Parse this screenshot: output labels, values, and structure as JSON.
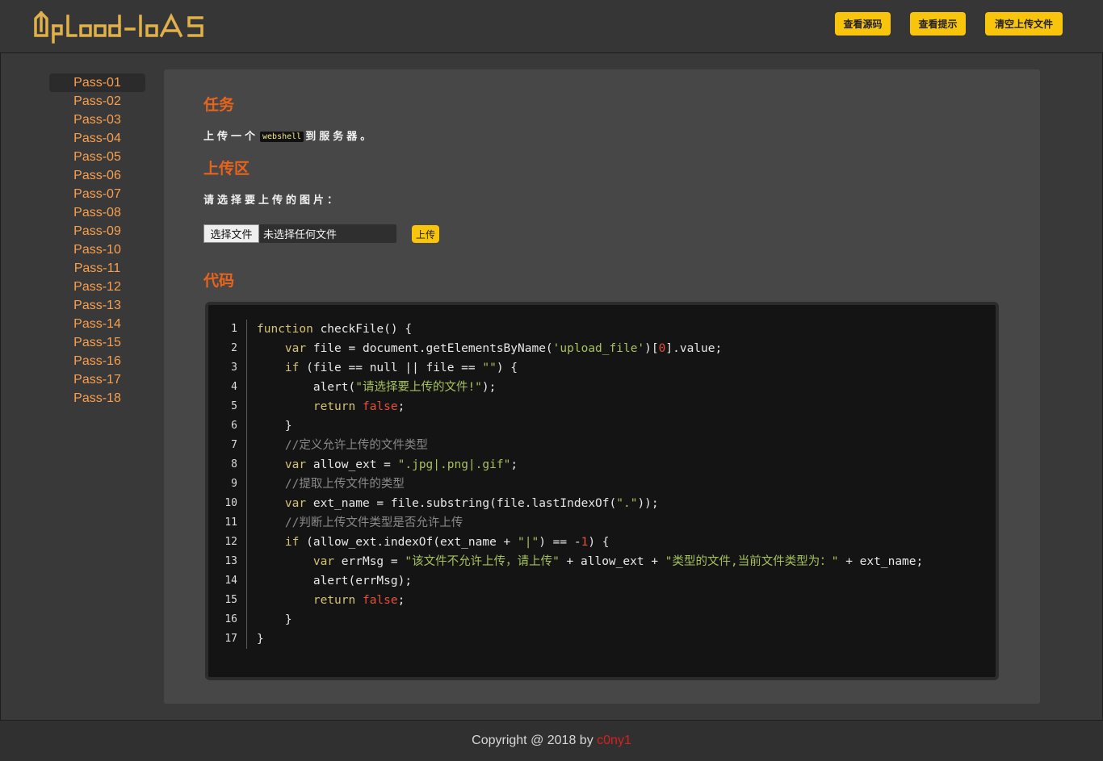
{
  "header": {
    "logo_text": "Upload-labs",
    "buttons": [
      "查看源码",
      "查看提示",
      "清空上传文件"
    ]
  },
  "sidebar": {
    "active_index": 0,
    "items": [
      "Pass-01",
      "Pass-02",
      "Pass-03",
      "Pass-04",
      "Pass-05",
      "Pass-06",
      "Pass-07",
      "Pass-08",
      "Pass-09",
      "Pass-10",
      "Pass-11",
      "Pass-12",
      "Pass-13",
      "Pass-14",
      "Pass-15",
      "Pass-16",
      "Pass-17",
      "Pass-18"
    ]
  },
  "task": {
    "title": "任务",
    "text_before": "上传一个",
    "code": "webshell",
    "text_after": "到服务器。"
  },
  "upload": {
    "title": "上传区",
    "prompt": "请选择要上传的图片：",
    "choose_file_label": "选择文件",
    "no_file_text": "未选择任何文件",
    "upload_button": "上传"
  },
  "code": {
    "title": "代码",
    "lines": [
      "function checkFile() {",
      "    var file = document.getElementsByName('upload_file')[0].value;",
      "    if (file == null || file == \"\") {",
      "        alert(\"请选择要上传的文件!\");",
      "        return false;",
      "    }",
      "    //定义允许上传的文件类型",
      "    var allow_ext = \".jpg|.png|.gif\";",
      "    //提取上传文件的类型",
      "    var ext_name = file.substring(file.lastIndexOf(\".\"));",
      "    //判断上传文件类型是否允许上传",
      "    if (allow_ext.indexOf(ext_name + \"|\") == -1) {",
      "        var errMsg = \"该文件不允许上传，请上传\" + allow_ext + \"类型的文件,当前文件类型为：\" + ext_name;",
      "        alert(errMsg);",
      "        return false;",
      "    }",
      "}"
    ]
  },
  "footer": {
    "copyright": "Copyright @ 2018 by ",
    "author": "c0ny1"
  },
  "colors": {
    "accent_button": "#f8c40c",
    "link_orange": "#f8a050",
    "title_orange": "#e8641c",
    "author_red": "#d82020",
    "code_keyword": "#d5c37a",
    "code_string": "#a5c25c",
    "code_number": "#e6503a",
    "code_comment": "#8a8a8a"
  }
}
